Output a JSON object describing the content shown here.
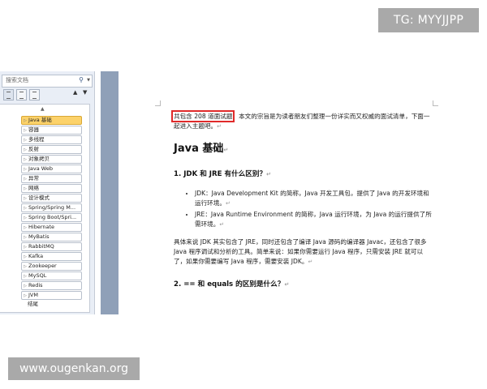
{
  "watermarks": {
    "top": "TG: MYYJJPP",
    "bottom": "www.ougenkan.org"
  },
  "nav": {
    "search_placeholder": "搜索文档",
    "search_icon": "search-icon",
    "up_arrow": "▲",
    "down_arrow": "▼",
    "collapse": "▲",
    "items": [
      {
        "label": "Java 基础",
        "active": true
      },
      {
        "label": "容器"
      },
      {
        "label": "多线程"
      },
      {
        "label": "反射"
      },
      {
        "label": "对象拷贝"
      },
      {
        "label": "Java Web"
      },
      {
        "label": "异常"
      },
      {
        "label": "网络"
      },
      {
        "label": "设计模式"
      },
      {
        "label": "Spring/Spring M..."
      },
      {
        "label": "Spring Boot/Spri..."
      },
      {
        "label": "Hibernate"
      },
      {
        "label": "MyBatis"
      },
      {
        "label": "RabbitMQ"
      },
      {
        "label": "Kafka"
      },
      {
        "label": "Zookeeper"
      },
      {
        "label": "MySQL"
      },
      {
        "label": "Redis"
      },
      {
        "label": "JVM"
      },
      {
        "label": "结尾",
        "plain": true
      }
    ]
  },
  "document": {
    "intro_highlight": "共包含 208 道面试题",
    "intro_rest": "，本文的宗旨是为读者朋友们整理一份详实而又权威的面试清单，下面一起进入主题吧。",
    "heading_main": "Java 基础",
    "q1": "1. JDK 和 JRE 有什么区别？",
    "bullet1": "JDK：Java Development Kit 的简称，Java 开发工具包，提供了 Java 的开发环境和运行环境。",
    "bullet2": "JRE：Java Runtime Environment 的简称，Java 运行环境，为 Java 的运行提供了所需环境。",
    "paragraph": "具体来说 JDK 其实包含了 JRE，同时还包含了编译 Java 源码的编译器 Javac，还包含了很多 Java 程序调试和分析的工具。简单来说：如果你需要运行 Java 程序，只需安装 JRE 就可以了，如果你需要编写 Java 程序，需要安装 JDK。",
    "q2": "2. == 和 equals 的区别是什么？",
    "paragraph_mark": "↵"
  },
  "colors": {
    "highlight_box": "#e02a2a",
    "active_nav": "#fcd26a",
    "divider": "#8fa0b8"
  }
}
